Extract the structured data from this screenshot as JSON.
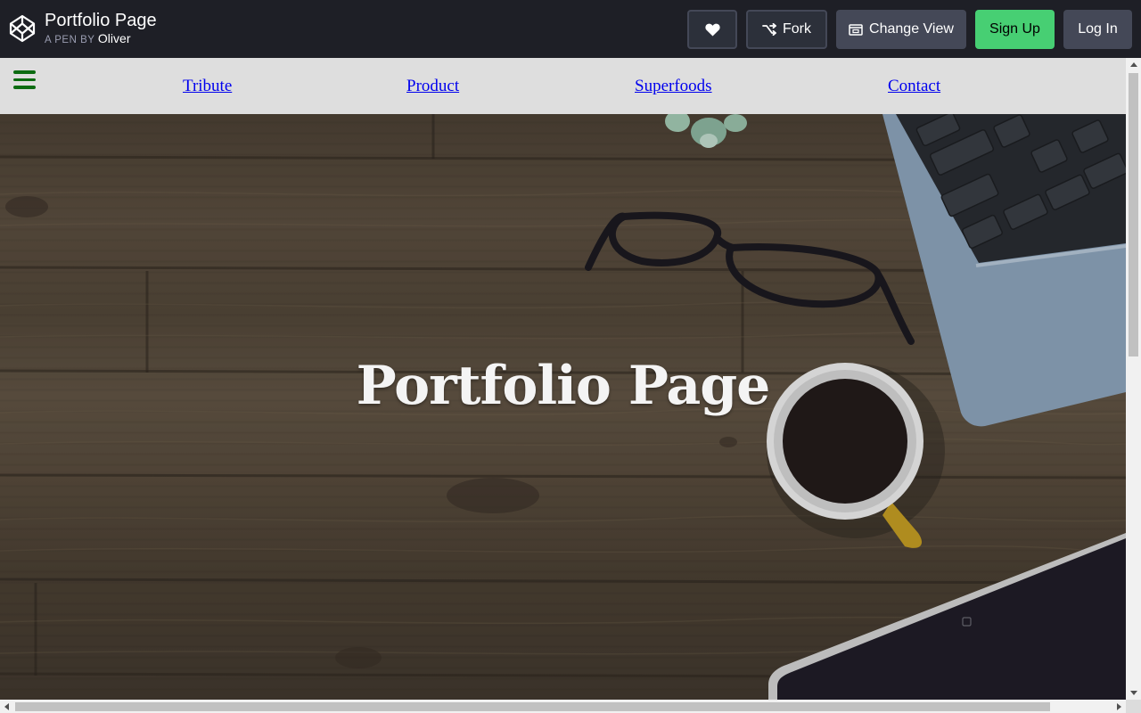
{
  "codepen": {
    "pen_title": "Portfolio Page",
    "byline_prefix": "A PEN BY",
    "author": "Oliver",
    "buttons": {
      "heart": "",
      "fork": "Fork",
      "change_view": "Change View",
      "sign_up": "Sign Up",
      "log_in": "Log In"
    },
    "colors": {
      "bar_bg": "#1e1f26",
      "signup_green": "#47cf73",
      "button_gray": "#444857"
    }
  },
  "page": {
    "nav": {
      "links": [
        "Tribute",
        "Product",
        "Superfoods",
        "Contact"
      ],
      "menu_icon": "hamburger-icon"
    },
    "hero": {
      "title": "Portfolio Page"
    },
    "colors": {
      "nav_bg": "#dedede",
      "menu_icon": "#0c6b11",
      "link": "#0000ee"
    }
  }
}
